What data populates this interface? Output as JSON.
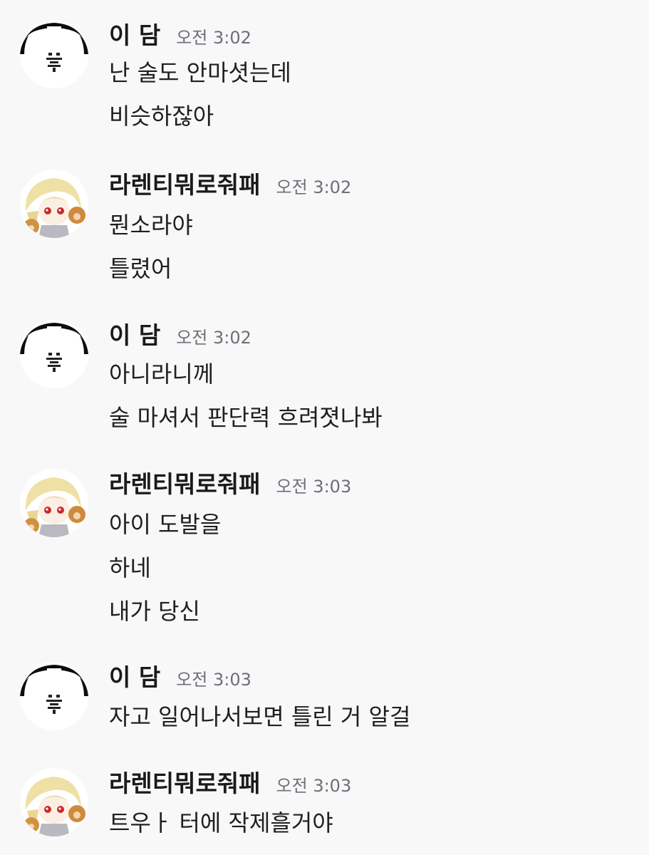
{
  "conversation": [
    {
      "author": "이 담",
      "avatar": "black-hood-sticker-avatar",
      "time": "오전 3:02",
      "lines": [
        "난 술도 안마셧는데",
        "비슷하잖아"
      ]
    },
    {
      "author": "라렌티뭐로줘패",
      "avatar": "blonde-chibi-avatar",
      "time": "오전 3:02",
      "lines": [
        "뭔소라야",
        "틀렸어"
      ]
    },
    {
      "author": "이 담",
      "avatar": "black-hood-sticker-avatar",
      "time": "오전 3:02",
      "lines": [
        "아니라니께",
        "술 마셔서 판단력 흐려졋나봐"
      ]
    },
    {
      "author": "라렌티뭐로줘패",
      "avatar": "blonde-chibi-avatar",
      "time": "오전 3:03",
      "lines": [
        "아이 도발을",
        "하네",
        "내가 당신"
      ]
    },
    {
      "author": "이 담",
      "avatar": "black-hood-sticker-avatar",
      "time": "오전 3:03",
      "lines": [
        "자고 일어나서보면 틀린 거 알걸"
      ]
    },
    {
      "author": "라렌티뭐로줘패",
      "avatar": "blonde-chibi-avatar",
      "time": "오전 3:03",
      "lines": [
        "트우ㅏ 터에 작제흘거야"
      ]
    }
  ]
}
